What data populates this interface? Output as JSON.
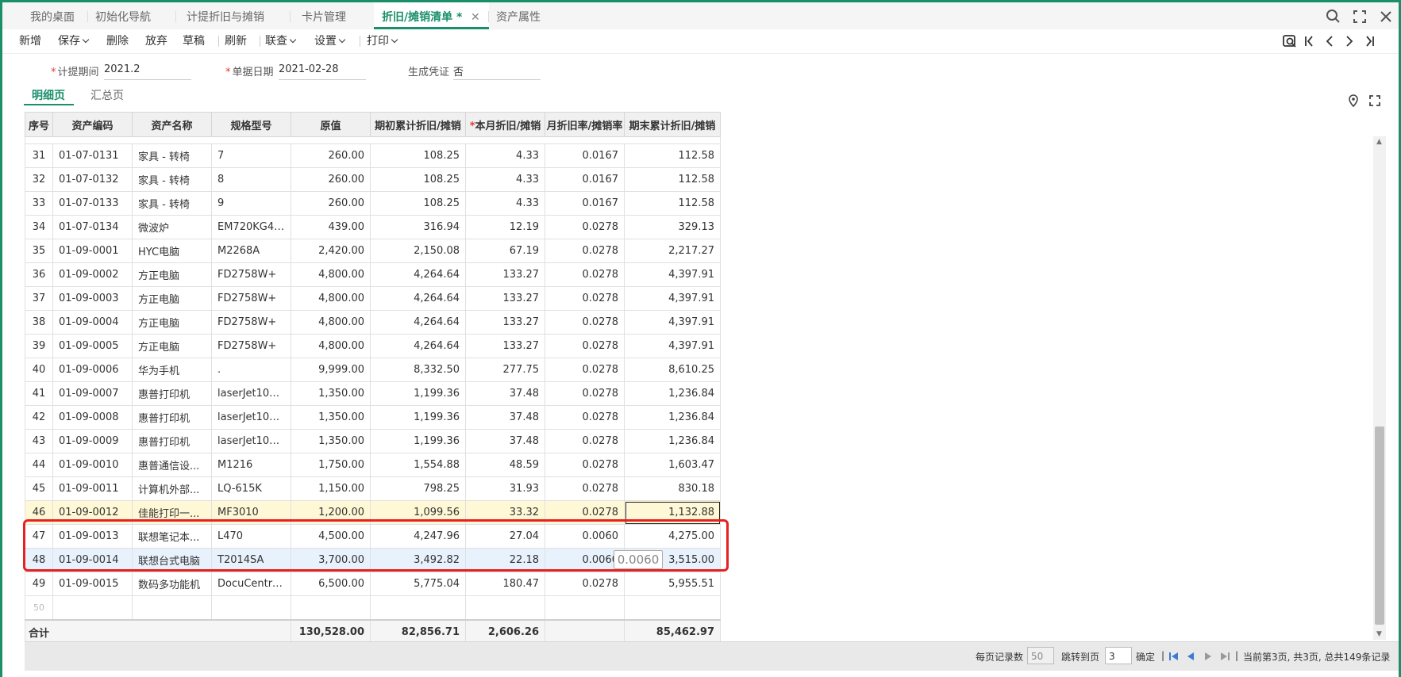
{
  "tabs": [
    {
      "label": "我的桌面"
    },
    {
      "label": "初始化导航"
    },
    {
      "label": "计提折旧与摊销"
    },
    {
      "label": "卡片管理"
    },
    {
      "label": "折旧/摊销清单 *"
    },
    {
      "label": "资产属性"
    }
  ],
  "toolbar": {
    "new": "新增",
    "save": "保存",
    "delete": "删除",
    "discard": "放弃",
    "draft": "草稿",
    "refresh": "刷新",
    "link": "联查",
    "settings": "设置",
    "print": "打印"
  },
  "form": {
    "period_label": "计提期间",
    "period_value": "2021.2",
    "date_label": "单据日期",
    "date_value": "2021-02-28",
    "voucher_label": "生成凭证",
    "voucher_value": "否"
  },
  "subtabs": {
    "detail": "明细页",
    "summary": "汇总页"
  },
  "table": {
    "headers": {
      "idx": "序号",
      "code": "资产编码",
      "name": "资产名称",
      "spec": "规格型号",
      "orig": "原值",
      "begin": "期初累计折旧/摊销",
      "req_mark": "*",
      "month": "本月折旧/摊销",
      "rate": "月折旧率/摊销率",
      "end": "期末累计折旧/摊销"
    },
    "rows": [
      {
        "idx": "31",
        "code": "01-07-0131",
        "name": "家具 - 转椅",
        "spec": "7",
        "orig": "260.00",
        "begin": "108.25",
        "month": "4.33",
        "rate": "0.0167",
        "end": "112.58"
      },
      {
        "idx": "32",
        "code": "01-07-0132",
        "name": "家具 - 转椅",
        "spec": "8",
        "orig": "260.00",
        "begin": "108.25",
        "month": "4.33",
        "rate": "0.0167",
        "end": "112.58"
      },
      {
        "idx": "33",
        "code": "01-07-0133",
        "name": "家具 - 转椅",
        "spec": "9",
        "orig": "260.00",
        "begin": "108.25",
        "month": "4.33",
        "rate": "0.0167",
        "end": "112.58"
      },
      {
        "idx": "34",
        "code": "01-07-0134",
        "name": "微波炉",
        "spec": "EM720KG4-...",
        "orig": "439.00",
        "begin": "316.94",
        "month": "12.19",
        "rate": "0.0278",
        "end": "329.13"
      },
      {
        "idx": "35",
        "code": "01-09-0001",
        "name": "HYC电脑",
        "spec": "M2268A",
        "orig": "2,420.00",
        "begin": "2,150.08",
        "month": "67.19",
        "rate": "0.0278",
        "end": "2,217.27"
      },
      {
        "idx": "36",
        "code": "01-09-0002",
        "name": "方正电脑",
        "spec": "FD2758W+",
        "orig": "4,800.00",
        "begin": "4,264.64",
        "month": "133.27",
        "rate": "0.0278",
        "end": "4,397.91"
      },
      {
        "idx": "37",
        "code": "01-09-0003",
        "name": "方正电脑",
        "spec": "FD2758W+",
        "orig": "4,800.00",
        "begin": "4,264.64",
        "month": "133.27",
        "rate": "0.0278",
        "end": "4,397.91"
      },
      {
        "idx": "38",
        "code": "01-09-0004",
        "name": "方正电脑",
        "spec": "FD2758W+",
        "orig": "4,800.00",
        "begin": "4,264.64",
        "month": "133.27",
        "rate": "0.0278",
        "end": "4,397.91"
      },
      {
        "idx": "39",
        "code": "01-09-0005",
        "name": "方正电脑",
        "spec": "FD2758W+",
        "orig": "4,800.00",
        "begin": "4,264.64",
        "month": "133.27",
        "rate": "0.0278",
        "end": "4,397.91"
      },
      {
        "idx": "40",
        "code": "01-09-0006",
        "name": "华为手机",
        "spec": ".",
        "orig": "9,999.00",
        "begin": "8,332.50",
        "month": "277.75",
        "rate": "0.0278",
        "end": "8,610.25"
      },
      {
        "idx": "41",
        "code": "01-09-0007",
        "name": "惠普打印机",
        "spec": "laserJet102...",
        "orig": "1,350.00",
        "begin": "1,199.36",
        "month": "37.48",
        "rate": "0.0278",
        "end": "1,236.84"
      },
      {
        "idx": "42",
        "code": "01-09-0008",
        "name": "惠普打印机",
        "spec": "laserJet102...",
        "orig": "1,350.00",
        "begin": "1,199.36",
        "month": "37.48",
        "rate": "0.0278",
        "end": "1,236.84"
      },
      {
        "idx": "43",
        "code": "01-09-0009",
        "name": "惠普打印机",
        "spec": "laserJet102...",
        "orig": "1,350.00",
        "begin": "1,199.36",
        "month": "37.48",
        "rate": "0.0278",
        "end": "1,236.84"
      },
      {
        "idx": "44",
        "code": "01-09-0010",
        "name": "惠普通信设...",
        "spec": "M1216",
        "orig": "1,750.00",
        "begin": "1,554.88",
        "month": "48.59",
        "rate": "0.0278",
        "end": "1,603.47"
      },
      {
        "idx": "45",
        "code": "01-09-0011",
        "name": "计算机外部...",
        "spec": "LQ-615K",
        "orig": "1,150.00",
        "begin": "798.25",
        "month": "31.93",
        "rate": "0.0278",
        "end": "830.18"
      },
      {
        "idx": "46",
        "code": "01-09-0012",
        "name": "佳能打印一...",
        "spec": "MF3010",
        "orig": "1,200.00",
        "begin": "1,099.56",
        "month": "33.32",
        "rate": "0.0278",
        "end": "1,132.88"
      },
      {
        "idx": "47",
        "code": "01-09-0013",
        "name": "联想笔记本...",
        "spec": "L470",
        "orig": "4,500.00",
        "begin": "4,247.96",
        "month": "27.04",
        "rate": "0.0060",
        "end": "4,275.00"
      },
      {
        "idx": "48",
        "code": "01-09-0014",
        "name": "联想台式电脑",
        "spec": "T2014SA",
        "orig": "3,700.00",
        "begin": "3,492.82",
        "month": "22.18",
        "rate": "0.0060",
        "end": "3,515.00"
      },
      {
        "idx": "49",
        "code": "01-09-0015",
        "name": "数码多功能机",
        "spec": "DocuCentre...",
        "orig": "6,500.00",
        "begin": "5,775.04",
        "month": "180.47",
        "rate": "0.0278",
        "end": "5,955.51"
      }
    ],
    "empty_row_idx": "50",
    "total": {
      "label": "合计",
      "orig": "130,528.00",
      "begin": "82,856.71",
      "month": "2,606.26",
      "end": "85,462.97"
    },
    "editing_value": "0.0060"
  },
  "footer": {
    "page_size_label": "每页记录数",
    "page_size_value": "50",
    "jump_label": "跳转到页",
    "jump_value": "3",
    "confirm": "确定",
    "sep": "|",
    "status": "当前第3页, 共3页, 总共149条记录"
  },
  "colors": {
    "accent": "#1a8f6a",
    "highlight_box": "#e52222",
    "row_highlight": "#fff8d6",
    "row_selected": "#e8f2fd"
  }
}
